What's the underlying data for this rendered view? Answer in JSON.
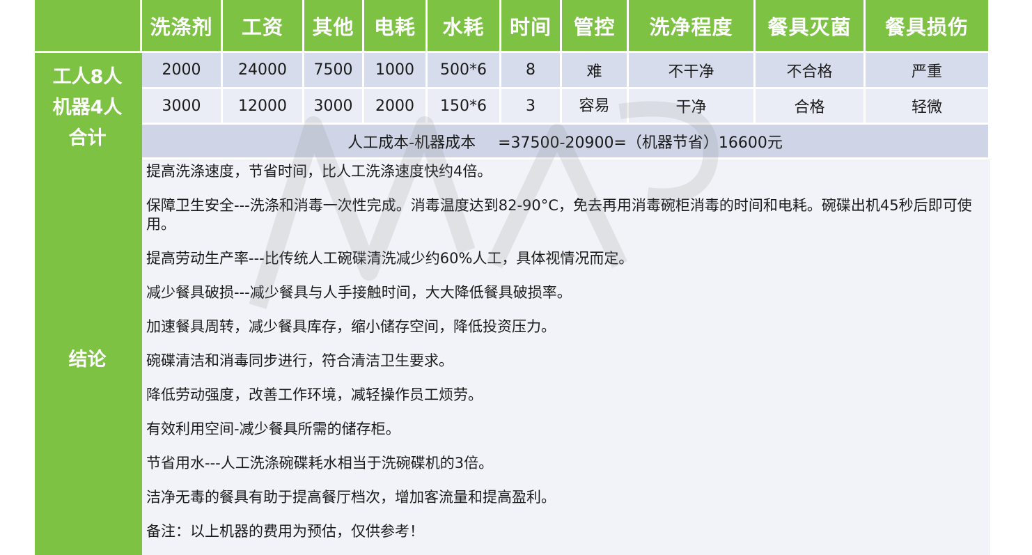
{
  "header": {
    "columns": [
      "洗涤剂",
      "工资",
      "其他",
      "电耗",
      "水耗",
      "时间",
      "管控",
      "洗净程度",
      "餐具灭菌",
      "餐具损伤"
    ]
  },
  "side": {
    "row1": "工人8人",
    "row2": "机器4人",
    "row3": "合计",
    "conclusion": "结论"
  },
  "rows": [
    {
      "values": [
        "2000",
        "24000",
        "7500",
        "1000",
        "500*6",
        "8",
        "难",
        "不干净",
        "不合格",
        "严重"
      ]
    },
    {
      "values": [
        "3000",
        "12000",
        "3000",
        "2000",
        "150*6",
        "3",
        "容易",
        "干净",
        "合格",
        "轻微"
      ]
    }
  ],
  "summary": {
    "left": "人工成本-机器成本",
    "right": "=37500-20900=（机器节省）16600元"
  },
  "conclusions": [
    "提高洗涤速度，节省时间，比人工洗涤速度快约4倍。",
    "保障卫生安全---洗涤和消毒一次性完成。消毒温度达到82-90°C，免去再用消毒碗柜消毒的时间和电耗。碗碟出机45秒后即可使用。",
    "提高劳动生产率---比传统人工碗碟清洗减少约60%人工，具体视情况而定。",
    "减少餐具破损---减少餐具与人手接触时间，大大降低餐具破损率。",
    "加速餐具周转，减少餐具库存，缩小储存空间，降低投资压力。",
    "碗碟清洁和消毒同步进行，符合清洁卫生要求。",
    "降低劳动强度，改善工作环境，减轻操作员工烦劳。",
    "有效利用空间-减少餐具所需的储存柜。",
    "节省用水---人工洗涤碗碟耗水相当于洗碗碟机的3倍。",
    "洁净无毒的餐具有助于提高餐厅档次，增加客流量和提高盈利。",
    "备注：以上机器的费用为预估，仅供参考！"
  ],
  "colors": {
    "green": "#7dc242",
    "row1": "#d6dceb",
    "row2": "#eaedf5",
    "summary": "#cfd5e6",
    "conclusion_bg": "#f1f3f8"
  }
}
